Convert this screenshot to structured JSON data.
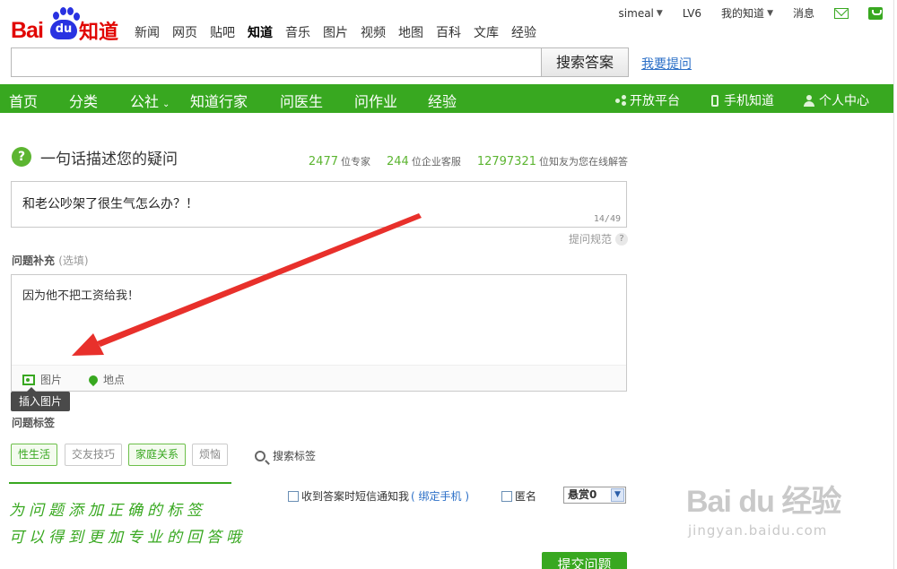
{
  "header": {
    "username": "simeal",
    "level": "LV6",
    "my_zhidao": "我的知道",
    "messages": "消息",
    "logo": {
      "bai": "Bai",
      "du": "du",
      "zhidao": "知道"
    },
    "nav": [
      "新闻",
      "网页",
      "贴吧",
      "知道",
      "音乐",
      "图片",
      "视频",
      "地图",
      "百科",
      "文库",
      "经验"
    ],
    "nav_active": "知道",
    "search": {
      "value": "",
      "button": "搜索答案",
      "ask_link": "我要提问"
    }
  },
  "greenbar": {
    "items": [
      "首页",
      "分类",
      "公社",
      "知道行家",
      "问医生",
      "问作业",
      "经验"
    ],
    "right": [
      "开放平台",
      "手机知道",
      "个人中心"
    ]
  },
  "question": {
    "heading": "一句话描述您的疑问",
    "stats": [
      {
        "num": "2477",
        "label": "位专家"
      },
      {
        "num": "244",
        "label": "位企业客服"
      },
      {
        "num": "12797321",
        "label": "位知友为您在线解答"
      }
    ],
    "text": "和老公吵架了很生气怎么办？！",
    "count": "14/49",
    "guide": "提问规范"
  },
  "supplement": {
    "label": "问题补充",
    "optional": "(选填)",
    "text": "因为他不把工资给我！",
    "tools": {
      "image": "图片",
      "location": "地点"
    },
    "tooltip": "插入图片"
  },
  "tags": {
    "label": "问题标签",
    "items": [
      {
        "text": "性生活",
        "selected": true
      },
      {
        "text": "交友技巧",
        "selected": false
      },
      {
        "text": "家庭关系",
        "selected": true
      },
      {
        "text": "烦恼",
        "selected": false
      }
    ],
    "search": "搜索标签"
  },
  "annotation": {
    "line1": "为问题添加正确的标签",
    "line2": "可以得到更加专业的回答哦"
  },
  "options": {
    "sms": "收到答案时短信通知我",
    "bind": "( 绑定手机 )",
    "anonymous": "匿名",
    "reward": "悬赏0"
  },
  "submit": "提交问题",
  "watermark": {
    "logo": "Bai  du 经验",
    "url": "jingyan.baidu.com"
  },
  "colors": {
    "green": "#38a820",
    "red": "#e10602",
    "blue": "#2932e1",
    "link": "#2b6fc7"
  }
}
